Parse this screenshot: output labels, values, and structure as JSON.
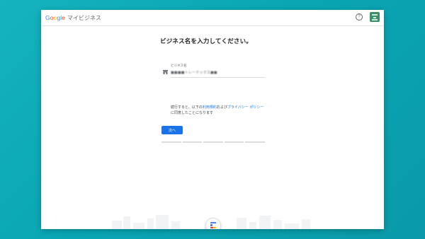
{
  "app": {
    "brand_letters": [
      "G",
      "o",
      "o",
      "g",
      "l",
      "e"
    ],
    "product_name": "マイビジネス",
    "help_symbol": "?"
  },
  "form": {
    "title": "ビジネス名を入力してください。",
    "field_label": "ビジネス名",
    "field_value": "■■■■トレーテックス■■",
    "terms_prefix": "続行すると、以下の",
    "terms_link1": "利用規約",
    "terms_middle": "および",
    "terms_link2": "プライバシー ポリシー",
    "terms_suffix": "に同意したことになります",
    "next_label": "次へ",
    "progress_total_steps": 5,
    "progress_completed_steps": 0
  },
  "colors": {
    "accent": "#1a73e8",
    "background": "#0aa6b4"
  },
  "icons": {
    "store": "store-icon",
    "help": "help-icon",
    "avatar": "account-avatar"
  }
}
